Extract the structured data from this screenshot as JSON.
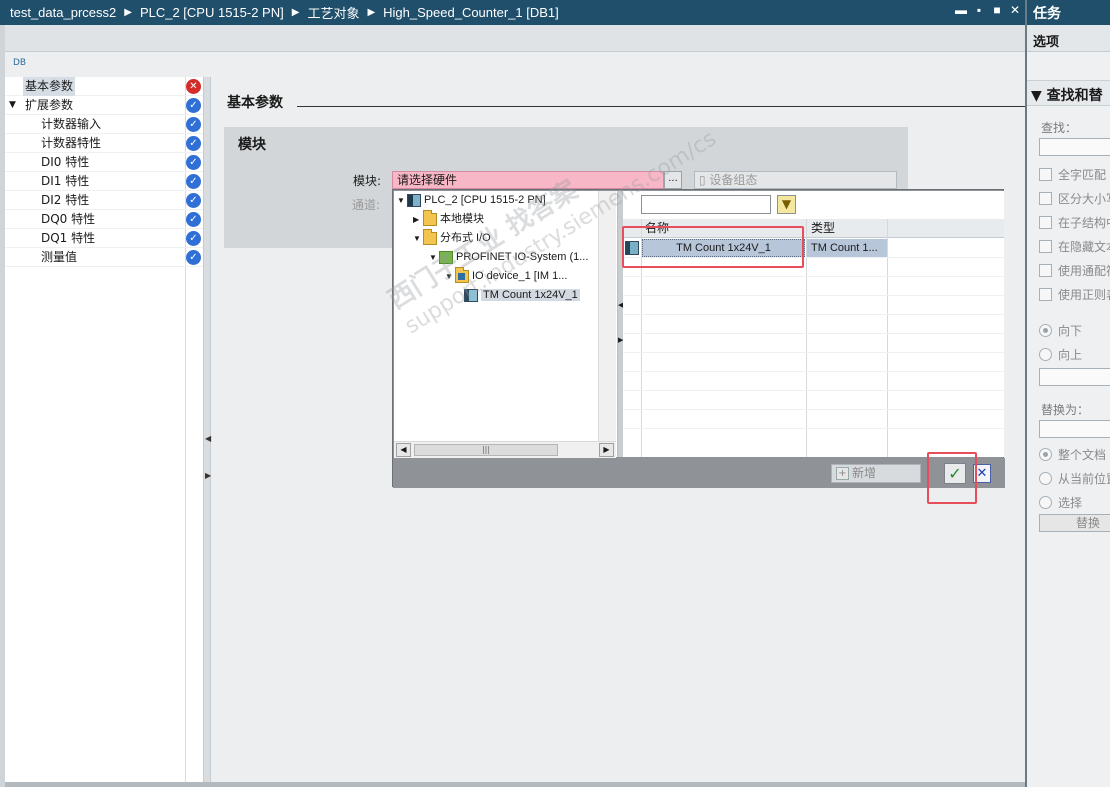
{
  "titlebar": {
    "crumbs": [
      "test_data_prcess2",
      "PLC_2 [CPU 1515-2 PN]",
      "工艺对象",
      "High_Speed_Counter_1 [DB1]"
    ],
    "win_controls": [
      "▬",
      "▪",
      "■",
      "✕"
    ]
  },
  "taskpane": {
    "title": "任务",
    "options": "选项",
    "section": "查找和替",
    "find_label": "查找：",
    "checkboxes": [
      "全字匹配",
      "区分大小写",
      "在子结构中",
      "在隐藏文本",
      "使用通配符",
      "使用正则表"
    ],
    "direction": [
      "向下",
      "向上"
    ],
    "replace_label": "替换为：",
    "scope": [
      "整个文档",
      "从当前位置",
      "选择"
    ],
    "replace_button": "替换"
  },
  "main": {
    "db_icon": "DB",
    "nav": [
      {
        "label": "基本参数",
        "status": "error",
        "status_icon": "✕"
      },
      {
        "label": "扩展参数",
        "status": "ok",
        "status_icon": "✓"
      },
      {
        "label": "计数器输入",
        "status": "ok",
        "status_icon": "✓"
      },
      {
        "label": "计数器特性",
        "status": "ok",
        "status_icon": "✓"
      },
      {
        "label": "DI0 特性",
        "status": "ok",
        "status_icon": "✓"
      },
      {
        "label": "DI1 特性",
        "status": "ok",
        "status_icon": "✓"
      },
      {
        "label": "DI2 特性",
        "status": "ok",
        "status_icon": "✓"
      },
      {
        "label": "DQ0 特性",
        "status": "ok",
        "status_icon": "✓"
      },
      {
        "label": "DQ1 特性",
        "status": "ok",
        "status_icon": "✓"
      },
      {
        "label": "测量值",
        "status": "ok",
        "status_icon": "✓"
      }
    ],
    "section_title": "基本参数",
    "module_panel": {
      "title": "模块",
      "module_label": "模块:",
      "module_value": "请选择硬件",
      "browse": "...",
      "channel_label": "通道:",
      "device_config": "设备组态"
    }
  },
  "popup": {
    "tree": [
      {
        "label": "PLC_2 [CPU 1515-2 PN]",
        "expander": "▼",
        "icon": "plc"
      },
      {
        "label": "本地模块",
        "expander": "▶",
        "icon": "folder"
      },
      {
        "label": "分布式 I/O",
        "expander": "▼",
        "icon": "folder"
      },
      {
        "label": "PROFINET IO-System (1...",
        "expander": "▼",
        "icon": "net"
      },
      {
        "label": "IO device_1 [IM 1...",
        "expander": "▼",
        "icon": "folder"
      },
      {
        "label": "TM Count 1x24V_1",
        "expander": "",
        "icon": "mod"
      }
    ],
    "scroll_thumb": "|||",
    "filter_icon": "funnel-icon",
    "columns": [
      "名称",
      "类型"
    ],
    "rows": [
      {
        "name": "TM Count 1x24V_1",
        "type": "TM Count 1..."
      }
    ],
    "add_button": "新增",
    "ok": "✓",
    "cancel": "✕"
  },
  "watermark": {
    "line1": "西门子工业  找答案",
    "line2": "support.industry.siemens.com/cs"
  },
  "colors": {
    "titlebar": "#1f4f6b",
    "highlight": "#e84d5b",
    "error": "#d42b2b",
    "ok": "#2f6fd6",
    "module_field": "#f7b7c6"
  }
}
